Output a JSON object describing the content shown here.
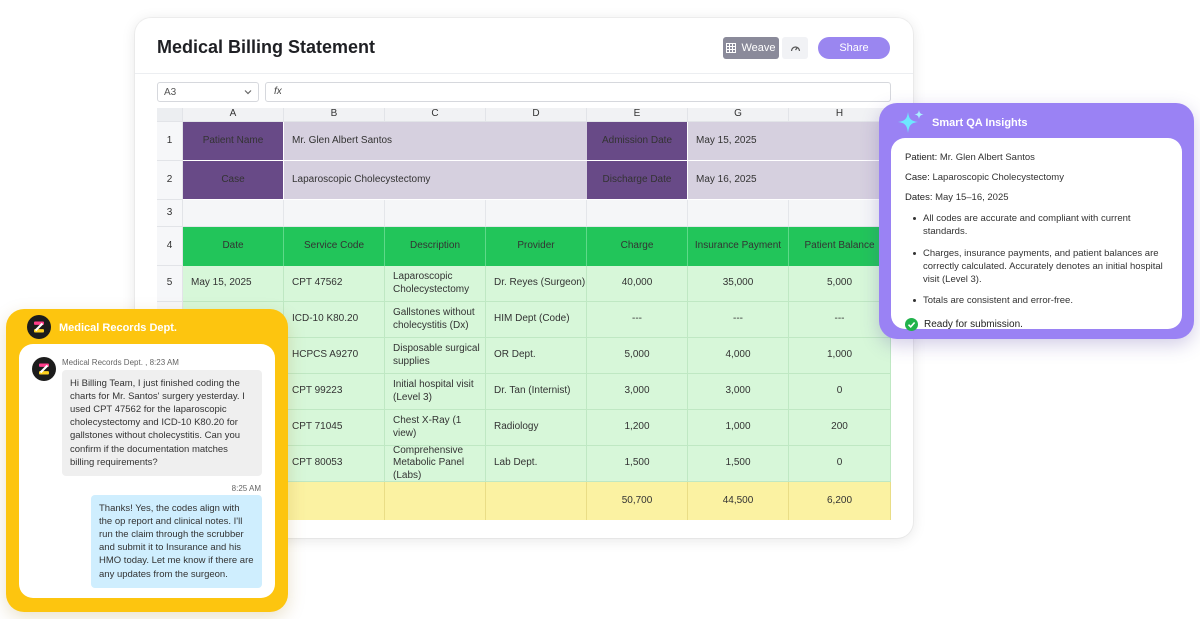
{
  "window": {
    "title": "Medical Billing Statement",
    "weave_label": "Weave",
    "share_label": "Share",
    "cell_ref": "A3",
    "fx_label": "fx"
  },
  "sheet": {
    "columns": [
      "A",
      "B",
      "C",
      "D",
      "E",
      "G",
      "H"
    ],
    "rows": [
      "1",
      "2",
      "3",
      "4",
      "5"
    ],
    "patient_label": "Patient Name",
    "patient_value": "Mr. Glen Albert Santos",
    "case_label": "Case",
    "case_value": "Laparoscopic Cholecystectomy",
    "admission_label": "Admission Date",
    "admission_value": "May 15, 2025",
    "discharge_label": "Discharge Date",
    "discharge_value": "May 16, 2025",
    "headers": [
      "Date",
      "Service Code",
      "Description",
      "Provider",
      "Charge",
      "Insurance Payment",
      "Patient Balance"
    ],
    "items": [
      {
        "date": "May 15, 2025",
        "code": "CPT 47562",
        "desc": "Laparoscopic Cholecystectomy",
        "provider": "Dr. Reyes (Surgeon)",
        "charge": "40,000",
        "insurance": "35,000",
        "balance": "5,000"
      },
      {
        "date": "",
        "code": "ICD-10 K80.20",
        "desc": "Gallstones without cholecystitis (Dx)",
        "provider": "HIM Dept (Code)",
        "charge": "---",
        "insurance": "---",
        "balance": "---"
      },
      {
        "date": "",
        "code": "HCPCS A9270",
        "desc": "Disposable surgical supplies",
        "provider": "OR Dept.",
        "charge": "5,000",
        "insurance": "4,000",
        "balance": "1,000"
      },
      {
        "date": "",
        "code": "CPT 99223",
        "desc": "Initial hospital visit (Level 3)",
        "provider": "Dr. Tan (Internist)",
        "charge": "3,000",
        "insurance": "3,000",
        "balance": "0"
      },
      {
        "date": "",
        "code": "CPT 71045",
        "desc": "Chest X-Ray (1 view)",
        "provider": "Radiology",
        "charge": "1,200",
        "insurance": "1,000",
        "balance": "200"
      },
      {
        "date": "",
        "code": "CPT 80053",
        "desc": "Comprehensive Metabolic Panel (Labs)",
        "provider": "Lab Dept.",
        "charge": "1,500",
        "insurance": "1,500",
        "balance": "0"
      }
    ],
    "totals": {
      "charge": "50,700",
      "insurance": "44,500",
      "balance": "6,200"
    }
  },
  "qa": {
    "title": "Smart QA Insights",
    "patient_key": "Patient:",
    "patient_val": "Mr. Glen Albert Santos",
    "case_key": "Case:",
    "case_val": "Laparoscopic Cholecystectomy",
    "dates_key": "Dates:",
    "dates_val": "May 15–16, 2025",
    "bullets": [
      "All codes are accurate and compliant with current standards.",
      "Charges, insurance payments, and patient balances are correctly calculated. Accurately denotes an initial hospital visit (Level 3).",
      "Totals are consistent and error-free."
    ],
    "ready": "Ready for submission."
  },
  "chat": {
    "title": "Medical Records Dept.",
    "incoming_meta": "Medical Records Dept. , 8:23 AM",
    "incoming_text": "Hi Billing Team, I just finished coding the charts for Mr. Santos' surgery yesterday. I used CPT 47562 for the laparoscopic cholecystectomy and ICD-10 K80.20 for gallstones without cholecystitis. Can you confirm if the documentation matches billing requirements?",
    "outgoing_time": "8:25 AM",
    "outgoing_text": "Thanks! Yes, the codes align with the op report and clinical notes. I'll run the claim through the scrubber and submit it to Insurance and his HMO today. Let me know if there are any updates from the surgeon."
  },
  "colors": {
    "label_purple": "#684a87",
    "header_green": "#22c55a",
    "row_green": "#d7f7d9",
    "total_yellow": "#fbf2a2",
    "qa_purple": "#9a82f4",
    "chat_yellow": "#fdc50f",
    "share_purple": "#9a86f0"
  },
  "icons": [
    "grid-icon",
    "gauge-icon",
    "chevron-down-icon",
    "sparkle-icon",
    "check-circle-icon",
    "dept-logo-icon"
  ]
}
